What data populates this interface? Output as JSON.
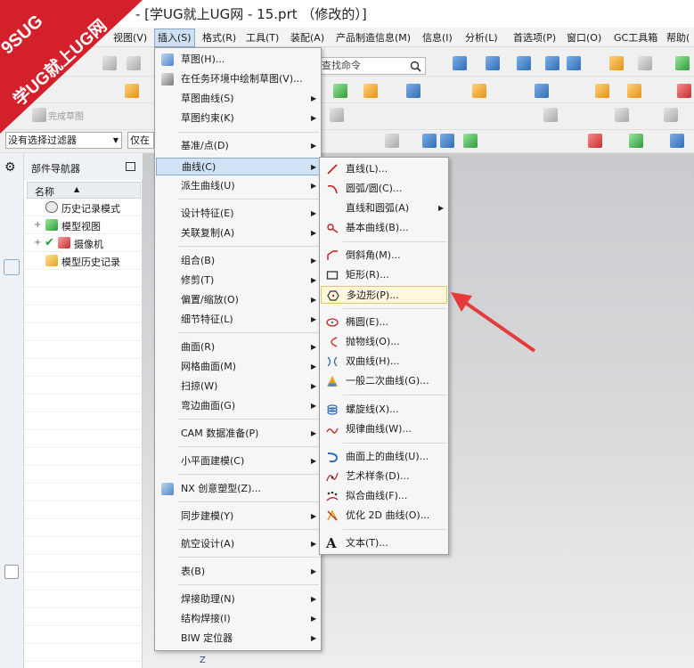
{
  "window": {
    "title": "- [学UG就上UG网 - 15.prt （修改的）]"
  },
  "watermark": {
    "line1": "9SUG",
    "line2": "学UG就上UG网"
  },
  "menubar": {
    "items": [
      "视图(V)",
      "插入(S)",
      "格式(R)",
      "工具(T)",
      "装配(A)",
      "产品制造信息(M)",
      "信息(I)",
      "分析(L)",
      "首选项(P)",
      "窗口(O)",
      "GC工具箱",
      "帮助("
    ],
    "active": "插入(S)"
  },
  "toolbar": {
    "search_placeholder": "查找命令",
    "finish_sketch": "完成草图",
    "filter_value": "没有选择过滤器",
    "scope_value": "仅在"
  },
  "navigator": {
    "title": "部件导航器",
    "column_name": "名称",
    "rows": [
      "历史记录模式",
      "模型视图",
      "摄像机",
      "模型历史记录"
    ]
  },
  "canvas": {
    "axis_label": "Z"
  },
  "insert_menu": {
    "items": [
      "草图(H)...",
      "在任务环境中绘制草图(V)...",
      "草图曲线(S)",
      "草图约束(K)",
      "基准/点(D)",
      "曲线(C)",
      "派生曲线(U)",
      "设计特征(E)",
      "关联复制(A)",
      "组合(B)",
      "修剪(T)",
      "偏置/缩放(O)",
      "细节特征(L)",
      "曲面(R)",
      "网格曲面(M)",
      "扫掠(W)",
      "弯边曲面(G)",
      "CAM 数据准备(P)",
      "小平面建模(C)",
      "NX 创意塑型(Z)...",
      "同步建模(Y)",
      "航空设计(A)",
      "表(B)",
      "焊接助理(N)",
      "结构焊接(I)",
      "BIW 定位器"
    ]
  },
  "curve_menu": {
    "items": [
      "直线(L)...",
      "圆弧/圆(C)...",
      "直线和圆弧(A)",
      "基本曲线(B)...",
      "倒斜角(M)...",
      "矩形(R)...",
      "多边形(P)...",
      "椭圆(E)...",
      "抛物线(O)...",
      "双曲线(H)...",
      "一般二次曲线(G)...",
      "螺旋线(X)...",
      "规律曲线(W)...",
      "曲面上的曲线(U)...",
      "艺术样条(D)...",
      "拟合曲线(F)...",
      "优化 2D 曲线(O)...",
      "文本(T)..."
    ],
    "highlighted": "多边形(P)..."
  },
  "colors": {
    "accent_red": "#d3202a",
    "menu_hover": "#cfe2f6",
    "arrow": "#e53b3b"
  },
  "icons": {
    "search": "search-icon",
    "arrow": "pointer-arrow"
  }
}
